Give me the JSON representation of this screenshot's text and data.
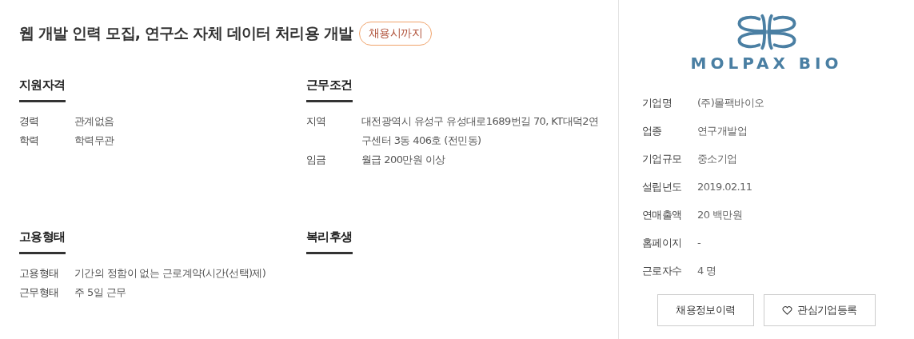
{
  "title": "웹 개발 인력 모집, 연구소 자체 데이터 처리용 개발",
  "deadline_badge": "채용시까지",
  "sections": [
    {
      "heading": "지원자격",
      "rows": [
        {
          "label": "경력",
          "value": "관계없음"
        },
        {
          "label": "학력",
          "value": "학력무관"
        }
      ]
    },
    {
      "heading": "근무조건",
      "rows": [
        {
          "label": "지역",
          "value": "대전광역시 유성구 유성대로1689번길 70, KT대덕2연구센터 3동 406호 (전민동)"
        },
        {
          "label": "임금",
          "value": "월급 200만원 이상"
        }
      ]
    },
    {
      "heading": "고용형태",
      "rows": [
        {
          "label": "고용형태",
          "value": "기간의 정함이 없는 근로계약(시간(선택)제)"
        },
        {
          "label": "근무형태",
          "value": "주 5일 근무"
        }
      ]
    },
    {
      "heading": "복리후생"
    }
  ],
  "company": {
    "logo_text": "MOLPAX BIO",
    "info": [
      {
        "label": "기업명",
        "value": "(주)몰팩바이오"
      },
      {
        "label": "업종",
        "value": "연구개발업"
      },
      {
        "label": "기업규모",
        "value": "중소기업"
      },
      {
        "label": "설립년도",
        "value": "2019.02.11"
      },
      {
        "label": "연매출액",
        "value": "20 백만원"
      },
      {
        "label": "홈페이지",
        "value": "-"
      },
      {
        "label": "근로자수",
        "value": "4 명"
      }
    ],
    "buttons": [
      {
        "kind": "plain",
        "label": "채용정보이력"
      },
      {
        "kind": "favorite",
        "label": "관심기업등록"
      }
    ]
  }
}
